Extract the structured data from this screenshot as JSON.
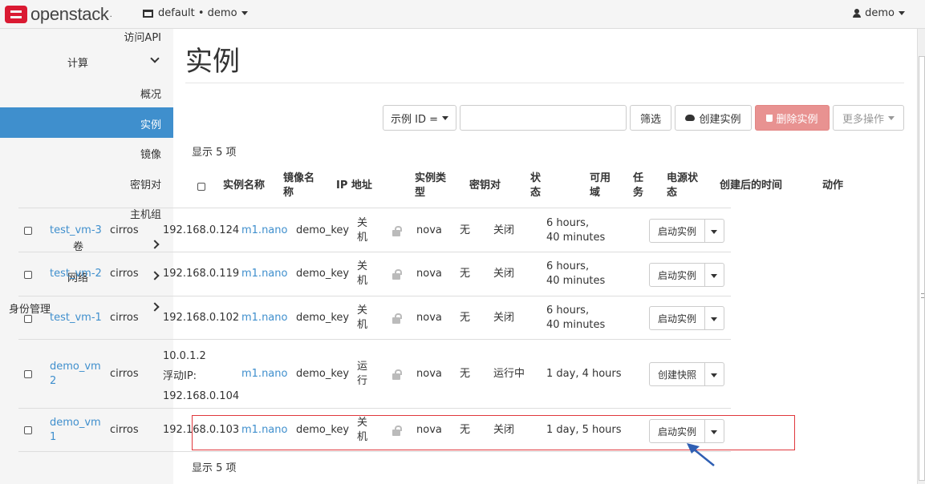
{
  "brand": {
    "name": "openstack",
    "logo_color": "#da1a32"
  },
  "header": {
    "project_selector": "default • demo",
    "user": "demo"
  },
  "sidebar": {
    "partial_item": "访问API",
    "compute": "计算",
    "overview": "概况",
    "instances": "实例",
    "images": "镜像",
    "keypairs": "密钥对",
    "host_aggregates": "主机组",
    "volumes": "卷",
    "network": "网络",
    "identity": "身份管理",
    "active_color": "#3f8fcd"
  },
  "page": {
    "title": "实例"
  },
  "toolbar": {
    "filter_field": "示例 ID =",
    "filter_value": "",
    "filter_button": "筛选",
    "create_button": "创建实例",
    "delete_button": "删除实例",
    "more_button": "更多操作",
    "danger_color": "#e89291"
  },
  "count_top": "显示 5 项",
  "count_bottom": "显示 5 项",
  "table": {
    "headers": {
      "name": "实例名称",
      "image_a": "镜像名",
      "image_b": "称",
      "ip": "IP 地址",
      "flavor_a": "实例类",
      "flavor_b": "型",
      "keypair": "密钥对",
      "status_a": "状",
      "status_b": "态",
      "az_a": "可用",
      "az_b": "域",
      "task_a": "任",
      "task_b": "务",
      "power_a": "电源状",
      "power_b": "态",
      "age": "创建后的时间",
      "actions": "动作"
    },
    "rows": [
      {
        "name_a": "test_vm-3",
        "name_b": "",
        "image": "cirros",
        "ip_a": "192.168.0.124",
        "ip_b": "",
        "ip_c": "",
        "flavor": "m1.nano",
        "keypair": "demo_key",
        "status_a": "关",
        "status_b": "机",
        "az": "nova",
        "task": "无",
        "power": "关闭",
        "age_a": "6 hours,",
        "age_b": "40 minutes",
        "action": "启动实例"
      },
      {
        "name_a": "test_vm-2",
        "name_b": "",
        "image": "cirros",
        "ip_a": "192.168.0.119",
        "ip_b": "",
        "ip_c": "",
        "flavor": "m1.nano",
        "keypair": "demo_key",
        "status_a": "关",
        "status_b": "机",
        "az": "nova",
        "task": "无",
        "power": "关闭",
        "age_a": "6 hours,",
        "age_b": "40 minutes",
        "action": "启动实例"
      },
      {
        "name_a": "test_vm-1",
        "name_b": "",
        "image": "cirros",
        "ip_a": "192.168.0.102",
        "ip_b": "",
        "ip_c": "",
        "flavor": "m1.nano",
        "keypair": "demo_key",
        "status_a": "关",
        "status_b": "机",
        "az": "nova",
        "task": "无",
        "power": "关闭",
        "age_a": "6 hours,",
        "age_b": "40 minutes",
        "action": "启动实例"
      },
      {
        "name_a": "demo_vm",
        "name_b": "2",
        "image": "cirros",
        "ip_a": "10.0.1.2",
        "ip_b": "浮动IP:",
        "ip_c": "192.168.0.104",
        "flavor": "m1.nano",
        "keypair": "demo_key",
        "status_a": "运",
        "status_b": "行",
        "az": "nova",
        "task": "无",
        "power": "运行中",
        "age_a": "1 day, 4 hours",
        "age_b": "",
        "action": "创建快照"
      },
      {
        "name_a": "demo_vm",
        "name_b": "1",
        "image": "cirros",
        "ip_a": "192.168.0.103",
        "ip_b": "",
        "ip_c": "",
        "flavor": "m1.nano",
        "keypair": "demo_key",
        "status_a": "关",
        "status_b": "机",
        "az": "nova",
        "task": "无",
        "power": "关闭",
        "age_a": "1 day, 5 hours",
        "age_b": "",
        "action": "启动实例"
      }
    ]
  },
  "annotation": {
    "highlight_color": "#e0383d",
    "arrow_color": "#2f5fb3"
  }
}
